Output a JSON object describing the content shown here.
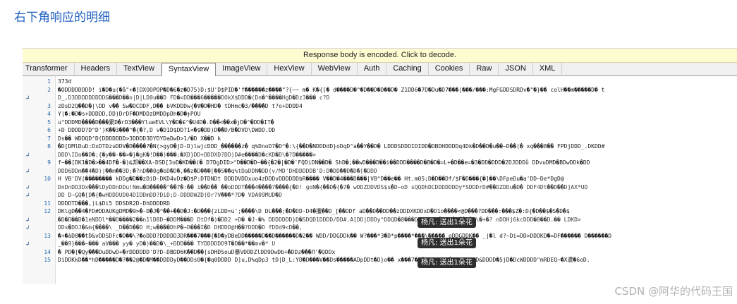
{
  "heading": "右下角响应的明细",
  "banner": "Response body is encoded. Click to decode.",
  "tabs": [
    "Transformer",
    "Headers",
    "TextView",
    "SyntaxView",
    "ImageView",
    "HexView",
    "WebView",
    "Auth",
    "Caching",
    "Cookies",
    "Raw",
    "JSON",
    "XML"
  ],
  "active_tab": "SyntaxView",
  "wrap_marker": "↲",
  "lines": [
    {
      "num": "1",
      "wrap": false,
      "text": "373d"
    },
    {
      "num": "2",
      "wrap": false,
      "text": "�ODDDDDDDD! i�D�u(�å\"+�]DXOOPOP�D�6�z�D75)D:$U'D$PID�'f������z����\"?{~~ m� K�{[� d����D�^�D��D�D��D� Z1DD6�7D�Du�D7���|���/���:MgFGDDSDRDv�\"�}��  colH��m�����D� t"
    },
    {
      "num": "",
      "wrap": true,
      "text": "D_,D3DDDDDDDDDG���D��o|D|LD0u��D FD�<DD���6�����DOkX$DDD�(Dn�^����HgD�Dz3��� c?D"
    },
    {
      "num": "3",
      "wrap": false,
      "text": "zDsD2Q��D�|\\DD v�� Sw�DCDDF,D�� bVKDDDw{�Ɐ�D�HD� tDHmc�3/����D  t?o+DDDD4"
    },
    {
      "num": "4",
      "wrap": false,
      "text": "Y|�:�D�s+DDDDD,DD)DrDF�DMDDzDMDDpDh�D�ɟPOU"
    },
    {
      "num": "5",
      "wrap": false,
      "text": "u^DDDMD����D���累D�rD3���YlueEVL\\Y�D�£^�U4D�.D��<��x�ȷD�^�DD�IT�"
    },
    {
      "num": "6",
      "wrap": false,
      "text": "+D   DDDDD?D^D')K��3���^�{�?,D v�D1D$DD?1<�$�DD)D��D/B�DVD\\DWDD.DD"
    },
    {
      "num": "7",
      "wrap": false,
      "text": "Ds�� WDDQD^D(DDDDDDD>3DDDD3DYDYDaDwD>1/�D X��D k"
    },
    {
      "num": "8",
      "wrap": false,
      "text": "�D[DMlDuD:DxDTDzuDDV�D����?�N(>gyD�jD-D)lwjcDDD_������z� q%DnoD7�D^�:\\{��D�NDDDdD}oDqD^a��Y��D� LDDDSDDDIDIDD�DBDHDDDDq4Dk�D��D�u��~D��(� xq���8�� FPDjDDD_.DKDD#"
    },
    {
      "num": "",
      "wrap": true,
      "text": "DDD\\IDo��D�;{�y��-��>�}�gK�!D��)���;�XD}DD+DDDXD?DD)D#e����D�cKD�D\\�?D�����>"
    },
    {
      "num": "9",
      "wrap": false,
      "text": "f~��[DK1�D�>��4DF�-�)ȡ邦��XA-DSD[3oD�KD��(� D7DgDID>^D��D�D~��{�2�|�D�'FQDiDN��D� ShD�;��wD���D��i��DDD����D�B�D�=L+�D��e=�3�DD�DDD�2DJDDDǜ DDvuDMD�BDwDDk�DD"
    },
    {
      "num": "",
      "wrap": true,
      "text": "DDD6DDm��4�D)|��m��3D;�?nD��0g�bD�D�,��z�D���[��S��q%tDaDDN�DD(v/MD'DHDDDDDB'D:D�DD��D�D�[�DDD"
    },
    {
      "num": "10",
      "wrap": false,
      "text": "H VB'DV(�������� kDDg�D��zDiD-DKD4vDz�D$P:DTDNDt DDDDVDDxuo4zDDDvDDDDDDbR���� V��D�4���D���|V8^D��e�� Ht.m05;D�D��Df/$F�D���{�]��\\DFpeDu�a'DD~De*DgD@"
    },
    {
      "num": "",
      "wrap": true,
      "text": "DnDnDD3Dx���lDyDDnDDu!Nmu�D�����^��7�:�� i��D�� ��oDDDT���4����7����{�D! goN�{��D�{�7� wDDZDDVDS$s�D~oD sQQDhDCDDDDDDDy*SDDDrD#��DZDDu�D� DDF4Dt��D��D]AX*UD"
    },
    {
      "num": "",
      "wrap": true,
      "text": "DD D~ĢQ�[D�{�wHDDDUD04DIDDmDD?DiD;D-DDDDWZD)Dr?V���*?D� VDA09MUD�D"
    },
    {
      "num": "11",
      "wrap": false,
      "text": "DDDDTD���,)L$Di5   DDSDR2D-DhDDDDRD"
    },
    {
      "num": "12",
      "wrap": false,
      "text": "DKlgD��4�FD#DDAUKgDMD�9>�-D�J�^��+��D�J:�D���{zLDD=u';����\\D DL���;�D�DD-D4�攫��D_[��DDf  aD��D��DD��zDDDXKDDxD�D1o����<@D���?DD���:���$Z�:D{�D��$�S�D�$"
    },
    {
      "num": "",
      "wrap": true,
      "text": "�D�D��D�1eNDDl*��D����2��n1lD8D~�DDM���D DtDf�)�DD2 +D� �J-�% DDDDDDD}D�SDQD1DDDD/DD#.A[DD|DDDy^DDQD�8���DDDLTD#� Qe�D��|�D\\�+�? nDDHj6kcDDD�8��D.�� LDKD>"
    },
    {
      "num": "",
      "wrap": true,
      "text": "DDs�DDJ�&m{����\\ _D��D��D H;w����DhP�~D���I�D DHDDD@H��?DDD�D fDDd9<D��,"
    },
    {
      "num": "13",
      "wrap": false,
      "text": "�+�àD8��tD&vDDSDFc�D��\\?�oDDD?DDDDD3DR���7���{�D�yDBeDD�����D��D������D�2�� WDD/DDGDDk�� W?���*3�D*p����*���\\����� oDDGDDK�� _|�l d?~Di=DD>DDDKD�=DF������ D������D"
    },
    {
      "num": "",
      "wrap": true,
      "text": "_��9}���~��� aV���  yy�     yD�)��D�\\_+DDD���  TYDDDDDD9T�D��*��mv�* U"
    },
    {
      "num": "14",
      "wrap": false,
      "text": "� PD�[�Qy���DuDDwD+�rDDDDDD'D?D-DBDD6K��D��[sDHDSouD暴VDDDZlDD9DwDb+�DDz���Л'�QDDx"
    },
    {
      "num": "15",
      "wrap": false,
      "text": "DiDDKkD��*hD�����D�?��2@�D�M��DDDDyD��DDs0�{�q0DDDD D]u,D%qDp3 tD|D_L:YD�D���V��Ds�����ADpDDt�D}o�� x���7�D�HbDDDDZ�j$bn%DMD&DDDD�5jD�DcWDDDD\"mRDEQ~�X遭�6oD."
    }
  ],
  "tooltips": [
    "杨凡: 送出1朵花",
    "杨凡: 送出1朵花",
    "杨凡: 送出1朵花"
  ],
  "watermark": "CSDN @阿华的代码王国",
  "colors": {
    "heading": "#1f5fbf",
    "banner_bg": "#fffbd0",
    "line_number": "#2b6cb0",
    "tooltip_bg": "#2e2e2e"
  }
}
